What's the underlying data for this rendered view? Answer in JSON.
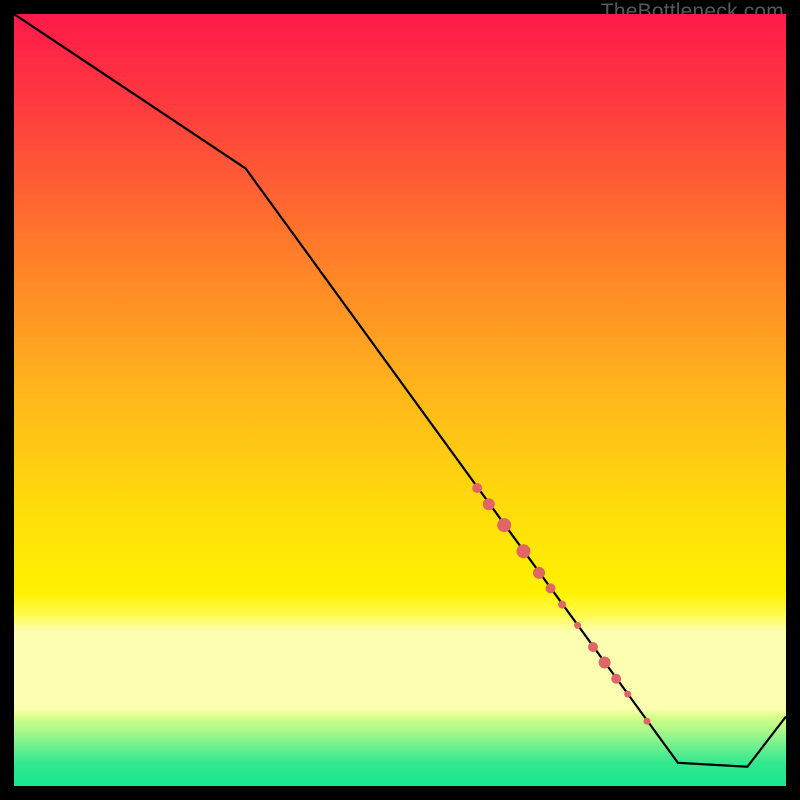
{
  "watermark": "TheBottleneck.com",
  "chart_data": {
    "type": "line",
    "xlim": [
      0,
      100
    ],
    "ylim": [
      0,
      100
    ],
    "title": "",
    "xlabel": "",
    "ylabel": "",
    "background_gradient": {
      "top": "#ff1a49",
      "middle": "#ffe000",
      "green_band_top": "#cfff66",
      "green_band_bottom": "#18e68e"
    },
    "line": {
      "color": "#000000",
      "points": [
        {
          "x": 0,
          "y": 100
        },
        {
          "x": 30,
          "y": 80
        },
        {
          "x": 86,
          "y": 3
        },
        {
          "x": 95,
          "y": 2.5
        },
        {
          "x": 100,
          "y": 9
        }
      ]
    },
    "dot_clusters": [
      {
        "x": 60.0,
        "y": 38.6,
        "r": 5
      },
      {
        "x": 61.5,
        "y": 36.5,
        "r": 6
      },
      {
        "x": 63.5,
        "y": 33.8,
        "r": 7
      },
      {
        "x": 66.0,
        "y": 30.4,
        "r": 7
      },
      {
        "x": 68.0,
        "y": 27.6,
        "r": 6
      },
      {
        "x": 69.5,
        "y": 25.6,
        "r": 5
      },
      {
        "x": 71.0,
        "y": 23.5,
        "r": 4
      },
      {
        "x": 73.0,
        "y": 20.8,
        "r": 3.5
      },
      {
        "x": 75.0,
        "y": 18.0,
        "r": 5
      },
      {
        "x": 76.5,
        "y": 16.0,
        "r": 6
      },
      {
        "x": 78.0,
        "y": 13.9,
        "r": 5
      },
      {
        "x": 79.5,
        "y": 11.9,
        "r": 3.5
      },
      {
        "x": 82.0,
        "y": 8.4,
        "r": 3.5
      }
    ],
    "dot_color": "#e06666"
  }
}
